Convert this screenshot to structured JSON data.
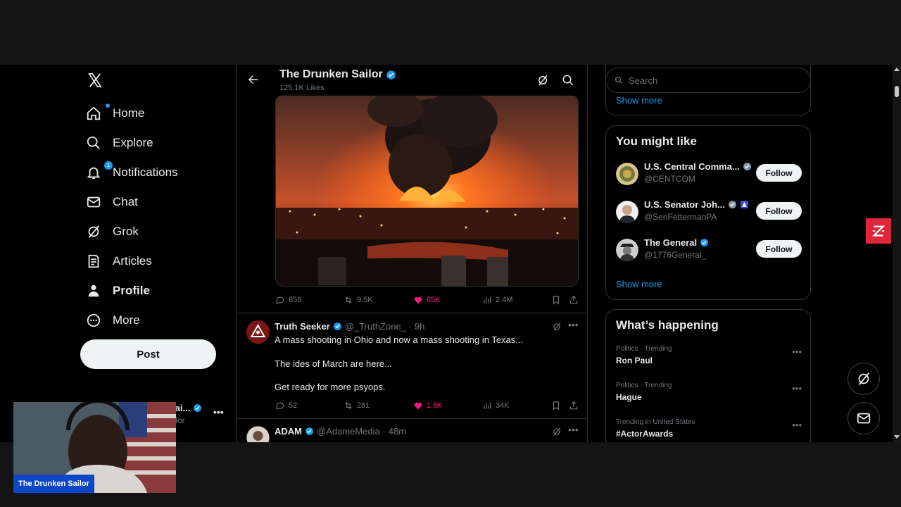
{
  "nav": {
    "items": [
      {
        "label": "Home",
        "icon": "home-icon"
      },
      {
        "label": "Explore",
        "icon": "search-icon"
      },
      {
        "label": "Notifications",
        "icon": "bell-icon",
        "badge": "1"
      },
      {
        "label": "Chat",
        "icon": "mail-icon"
      },
      {
        "label": "Grok",
        "icon": "grok-icon"
      },
      {
        "label": "Articles",
        "icon": "article-icon"
      },
      {
        "label": "Profile",
        "icon": "person-icon"
      },
      {
        "label": "More",
        "icon": "more-circle-icon"
      }
    ],
    "post_label": "Post",
    "account_name": "Sai...",
    "account_handle": "ailor"
  },
  "header": {
    "title": "The Drunken Sailor",
    "likes": "125.1K Likes"
  },
  "first_tweet_actions": {
    "replies": "858",
    "reposts": "9.5K",
    "likes": "65K",
    "views": "2.4M"
  },
  "tweets": [
    {
      "name": "Truth Seeker",
      "handle": "@_TruthZone_",
      "time": "· 9h",
      "lines": [
        "A mass shooting in Ohio and now a mass shooting in Texas...",
        "The ides of March are here...",
        "Get ready for more psyops."
      ],
      "replies": "52",
      "reposts": "281",
      "likes": "1.8K",
      "views": "34K"
    },
    {
      "name": "ADAM",
      "handle": "@AdameMedia",
      "time": "· 48m"
    }
  ],
  "right": {
    "search_placeholder": "Search",
    "show_more_top": "Show more",
    "might_like_title": "You might like",
    "suggestions": [
      {
        "name": "U.S. Central Comma...",
        "handle": "@CENTCOM",
        "follow": "Follow"
      },
      {
        "name": "U.S. Senator Joh...",
        "handle": "@SenFettermanPA",
        "follow": "Follow"
      },
      {
        "name": "The General",
        "handle": "@1776General_",
        "follow": "Follow"
      }
    ],
    "show_more": "Show more",
    "happening_title": "What’s happening",
    "trends": [
      {
        "category": "Politics · Trending",
        "title": "Ron Paul"
      },
      {
        "category": "Politics · Trending",
        "title": "Hague"
      },
      {
        "category": "Trending in United States",
        "title": "#ActorAwards"
      }
    ]
  },
  "webcam": {
    "label": "The Drunken Sailor"
  },
  "colors": {
    "accent": "#1d9bf0",
    "like": "#f91880",
    "background": "#000000",
    "border": "#2f3336"
  }
}
